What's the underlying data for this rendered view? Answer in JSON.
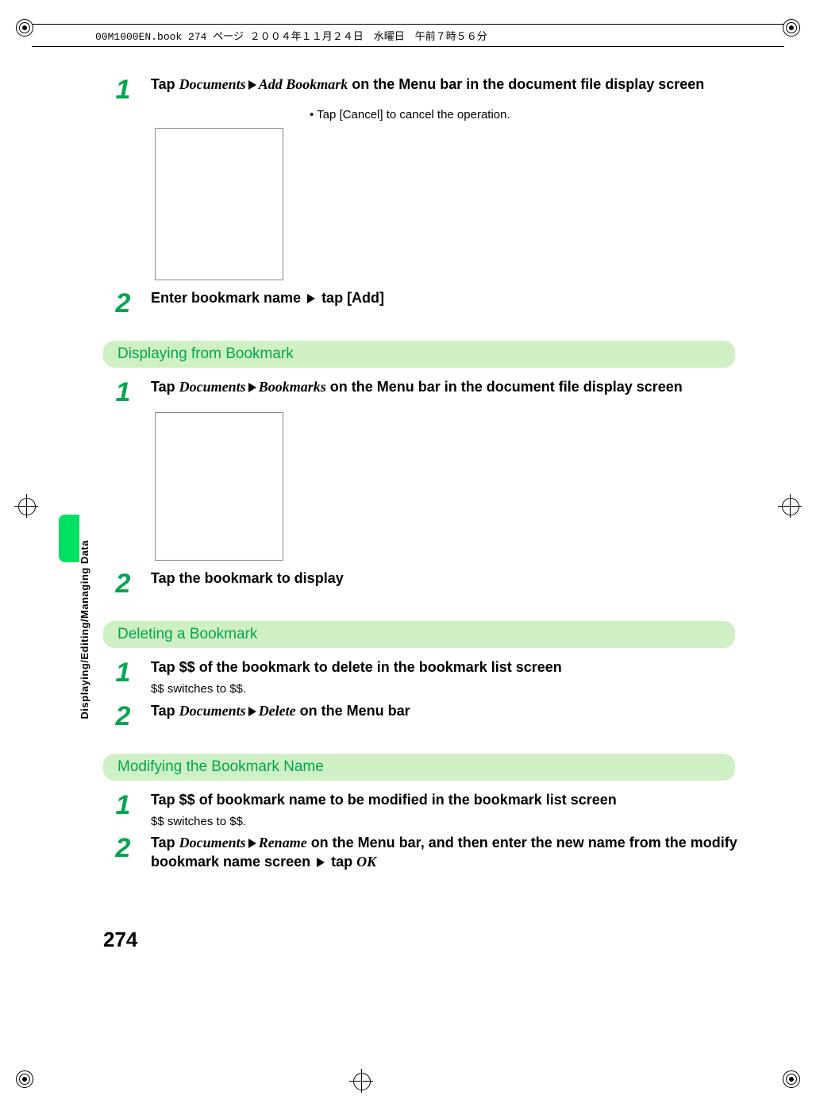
{
  "bookline": "00M1000EN.book  274 ページ  ２００４年１１月２４日　水曜日　午前７時５６分",
  "page_number": "274",
  "side_label": "Displaying/Editing/Managing Data",
  "intro_steps": [
    {
      "num": "1",
      "parts": [
        "Tap ",
        {
          "i": "Documents"
        },
        {
          "tri": true
        },
        {
          "i": "Add Bookmark"
        },
        " on the Menu bar in the document file display screen"
      ],
      "note": "Tap [Cancel] to cancel the operation."
    },
    {
      "num": "2",
      "parts": [
        "Enter bookmark name ",
        {
          "tri": true
        },
        " tap [Add]"
      ]
    }
  ],
  "sections": [
    {
      "title": "Displaying from Bookmark",
      "steps": [
        {
          "num": "1",
          "parts": [
            "Tap ",
            {
              "i": "Documents"
            },
            {
              "tri": true
            },
            {
              "i": "Bookmarks"
            },
            " on the Menu bar in the document file display screen"
          ],
          "has_img": true
        },
        {
          "num": "2",
          "parts": [
            "Tap the bookmark to display"
          ]
        }
      ]
    },
    {
      "title": "Deleting a Bookmark",
      "steps": [
        {
          "num": "1",
          "parts": [
            "Tap $$ of the bookmark to delete in the bookmark list screen"
          ],
          "sub": "$$ switches to $$."
        },
        {
          "num": "2",
          "parts": [
            "Tap ",
            {
              "i": "Documents"
            },
            {
              "tri": true
            },
            {
              "i": "Delete"
            },
            " on the Menu bar"
          ]
        }
      ]
    },
    {
      "title": "Modifying the Bookmark Name",
      "steps": [
        {
          "num": "1",
          "parts": [
            "Tap $$ of bookmark name to be modified in the bookmark list screen"
          ],
          "sub": "$$ switches to $$."
        },
        {
          "num": "2",
          "parts": [
            "Tap ",
            {
              "i": "Documents"
            },
            {
              "tri": true
            },
            {
              "i": "Rename"
            },
            " on the Menu bar, and then enter the new name from the modify bookmark name screen ",
            {
              "tri": true
            },
            " tap ",
            {
              "i": "OK"
            }
          ]
        }
      ]
    }
  ]
}
